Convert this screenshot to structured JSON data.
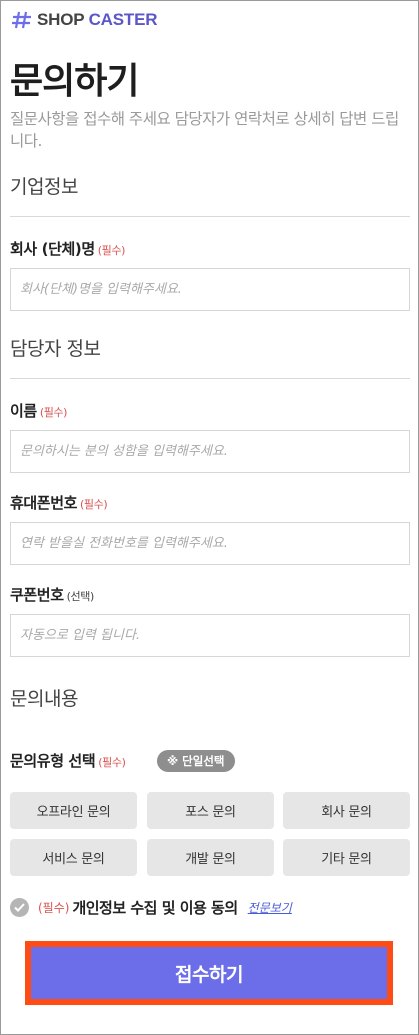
{
  "brand": {
    "logo_text_main": "SHOP",
    "logo_text_accent": "CASTER",
    "accent_color": "#6b6ee8"
  },
  "page": {
    "title": "문의하기",
    "subtitle": "질문사항을 접수해 주세요 담당자가 연락처로 상세히 답변 드립니다."
  },
  "company_section": {
    "heading": "기업정보",
    "company_name": {
      "label": "회사 (단체)명",
      "required_tag": "(필수)",
      "placeholder": "회사(단체)명을 입력해주세요.",
      "value": ""
    }
  },
  "contact_section": {
    "heading": "담당자 정보",
    "name": {
      "label": "이름",
      "required_tag": "(필수)",
      "placeholder": "문의하시는 분의 성함을 입력해주세요.",
      "value": ""
    },
    "phone": {
      "label": "휴대폰번호",
      "required_tag": "(필수)",
      "placeholder": "연락 받을실 전화번호를 입력해주세요.",
      "value": ""
    },
    "coupon": {
      "label": "쿠폰번호",
      "optional_tag": "(선택)",
      "placeholder": "자동으로 입력 됩니다.",
      "value": ""
    }
  },
  "inquiry_section": {
    "heading": "문의내용",
    "type_label": "문의유형 선택",
    "required_tag": "(필수)",
    "single_select_badge": "※ 단일선택",
    "types": [
      "오프라인 문의",
      "포스 문의",
      "회사 문의",
      "서비스 문의",
      "개발 문의",
      "기타 문의"
    ]
  },
  "agreement": {
    "required_tag": "(필수)",
    "text": "개인정보 수집 및 이용 동의",
    "view_link": "전문보기",
    "checked": false
  },
  "submit": {
    "label": "접수하기"
  },
  "icons": {
    "logo": "hash-logo-icon",
    "check": "check-icon"
  }
}
